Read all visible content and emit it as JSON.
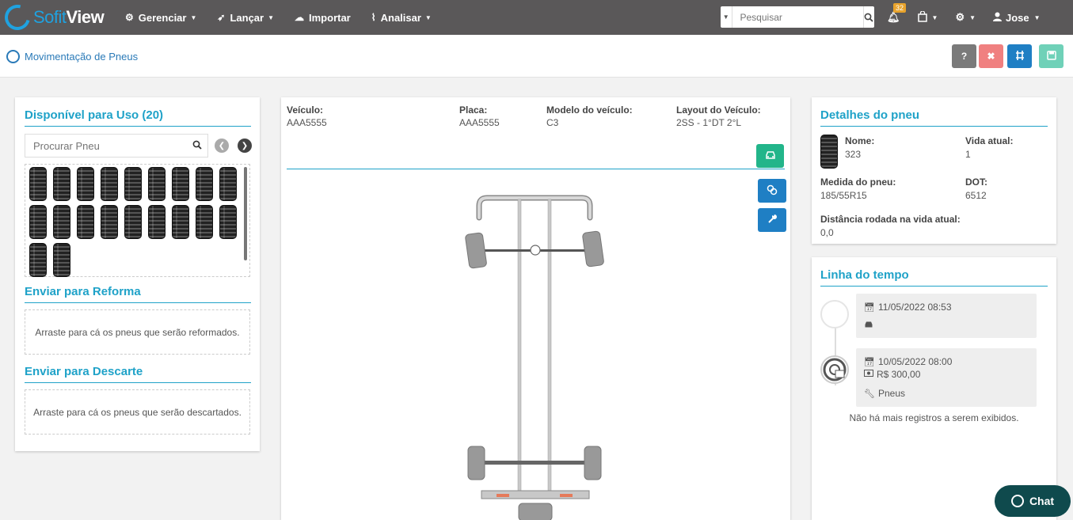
{
  "app": {
    "logo_soft": "Sofit",
    "logo_view": "View"
  },
  "nav": {
    "items": [
      {
        "label": "Gerenciar",
        "icon": "gear-icon",
        "glyph": "⚙",
        "has_caret": true
      },
      {
        "label": "Lançar",
        "icon": "rocket-icon",
        "glyph": "➶",
        "has_caret": true
      },
      {
        "label": "Importar",
        "icon": "cloud-upload-icon",
        "glyph": "☁",
        "has_caret": false
      },
      {
        "label": "Analisar",
        "icon": "line-chart-icon",
        "glyph": "⌇",
        "has_caret": true
      }
    ],
    "search_placeholder": "Pesquisar",
    "notifications_count": "32",
    "user_name": "Jose"
  },
  "breadcrumb": {
    "label": "Movimentação de Pneus"
  },
  "toolbar": {
    "help_label": "?",
    "cancel_label": "✖",
    "colors": {
      "help": "#7a7a7a",
      "cancel": "#f08080",
      "layout": "#1f7fc4",
      "save": "#6fd1b8"
    }
  },
  "left": {
    "available_title": "Disponível para Uso (20)",
    "search_placeholder": "Procurar Pneu",
    "tire_count": 20,
    "reform_title": "Enviar para Reforma",
    "reform_hint": "Arraste para cá os pneus que serão reformados.",
    "discard_title": "Enviar para Descarte",
    "discard_hint": "Arraste para cá os pneus que serão descartados."
  },
  "vehicle": {
    "vehicle_label": "Veículo:",
    "vehicle_value": "AAA5555",
    "plate_label": "Placa:",
    "plate_value": "AAA5555",
    "model_label": "Modelo do veículo:",
    "model_value": "C3",
    "layout_label": "Layout do Veículo:",
    "layout_value": "2SS - 1°DT 2°L"
  },
  "details": {
    "title": "Detalhes do pneu",
    "name_label": "Nome:",
    "name_value": "323",
    "life_label": "Vida atual:",
    "life_value": "1",
    "size_label": "Medida do pneu:",
    "size_value": "185/55R15",
    "dot_label": "DOT:",
    "dot_value": "6512",
    "distance_label": "Distância rodada na vida atual:",
    "distance_value": "0,0"
  },
  "timeline": {
    "title": "Linha do tempo",
    "entries": [
      {
        "date": "11/05/2022 08:53"
      },
      {
        "date": "10/05/2022 08:00",
        "amount": "R$ 300,00",
        "category": "Pneus"
      }
    ],
    "end_text": "Não há mais registros a serem exibidos."
  },
  "chat": {
    "label": "Chat"
  }
}
